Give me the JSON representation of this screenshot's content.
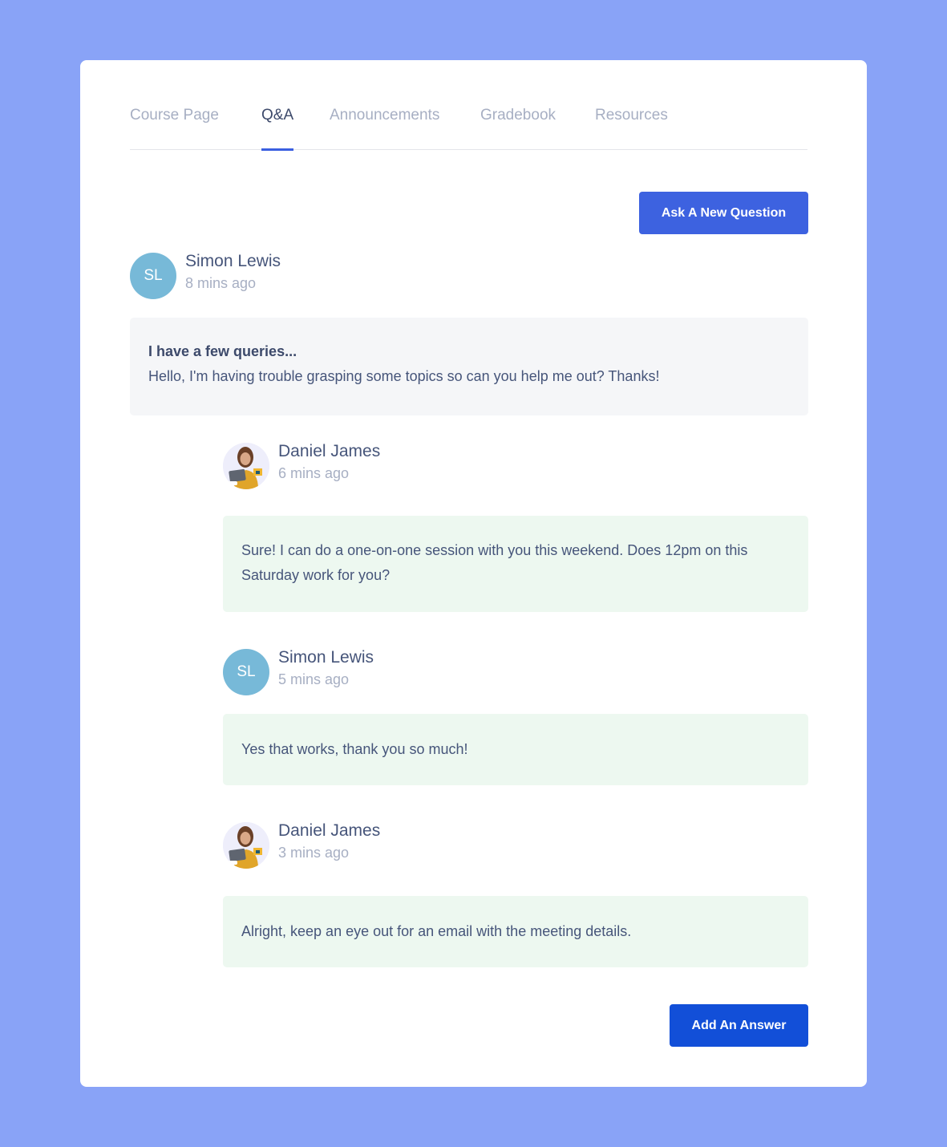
{
  "tabs": [
    {
      "label": "Course Page",
      "active": false
    },
    {
      "label": "Q&A",
      "active": true
    },
    {
      "label": "Announcements",
      "active": false
    },
    {
      "label": "Gradebook",
      "active": false
    },
    {
      "label": "Resources",
      "active": false
    }
  ],
  "actions": {
    "ask_question_label": "Ask A New Question",
    "add_answer_label": "Add An Answer"
  },
  "question": {
    "author": {
      "name": "Simon Lewis",
      "initials": "SL",
      "time": "8 mins ago"
    },
    "title": "I have a few queries...",
    "body": "Hello, I'm having trouble grasping some topics so can you help me out? Thanks!"
  },
  "replies": [
    {
      "author": {
        "name": "Daniel James",
        "avatar": "photo-avatar",
        "time": "6 mins ago"
      },
      "body": "Sure! I can do a one-on-one session with you this weekend. Does 12pm on this Saturday work for you?"
    },
    {
      "author": {
        "name": "Simon Lewis",
        "initials": "SL",
        "time": "5 mins ago"
      },
      "body": "Yes that works, thank you so much!"
    },
    {
      "author": {
        "name": "Daniel James",
        "avatar": "photo-avatar",
        "time": "3 mins ago"
      },
      "body": "Alright, keep an eye out for an email with the meeting details."
    }
  ],
  "colors": {
    "page_background": "#89a3f7",
    "primary_button": "#3d62e0",
    "answer_button": "#124fd8",
    "active_tab_underline": "#3b5fe0",
    "avatar_initials_bg": "#77b9d8",
    "question_bubble_bg": "#f5f6f8",
    "answer_bubble_bg": "#edf8f0"
  }
}
